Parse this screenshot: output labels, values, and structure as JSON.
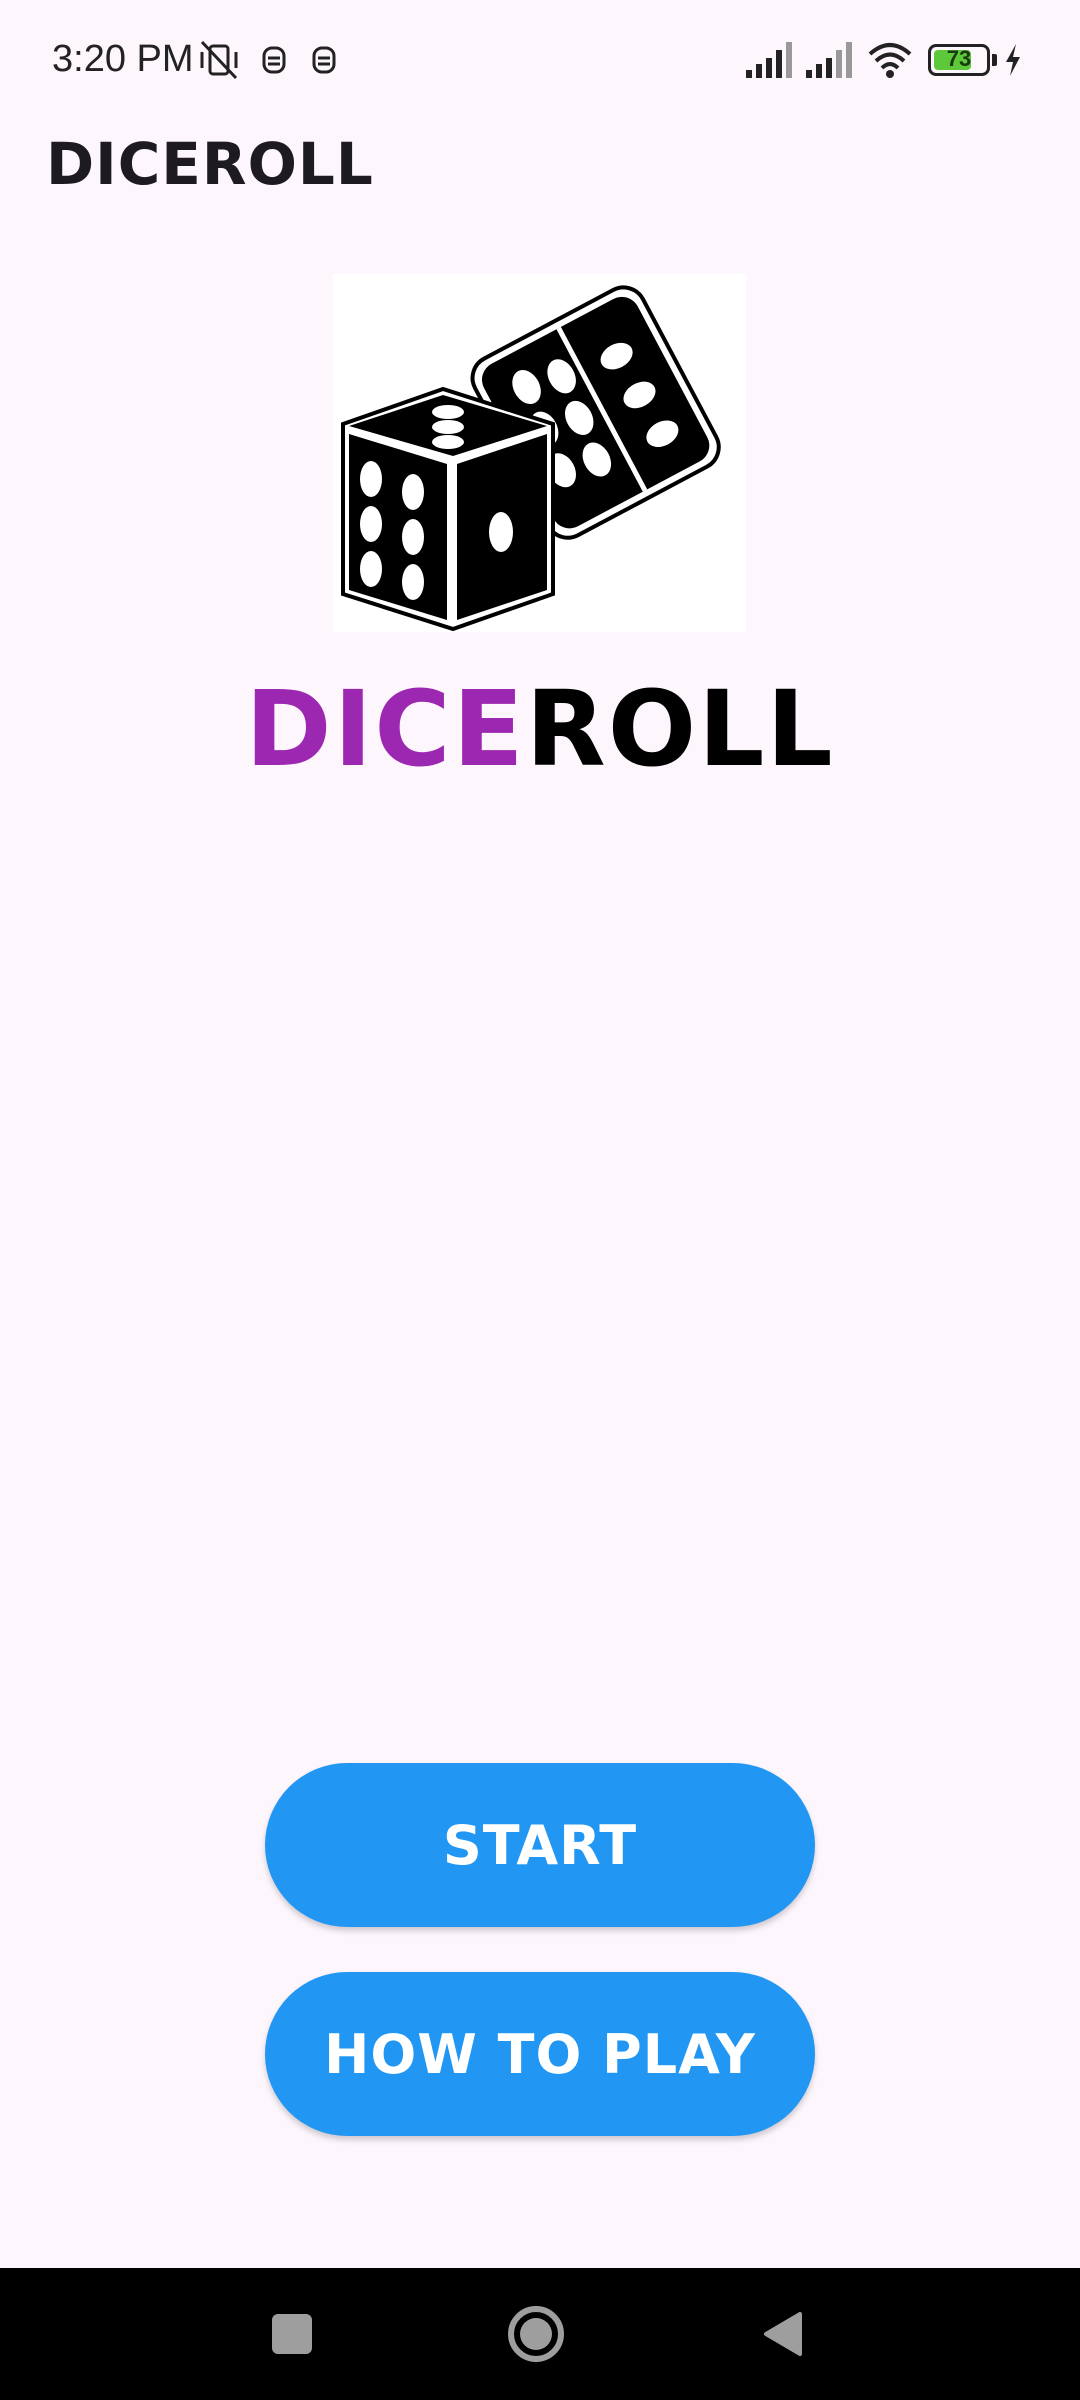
{
  "status_bar": {
    "time": "3:20 PM",
    "battery_level": "73",
    "battery_fraction": 0.73,
    "icons": [
      "muted-vibrate-icon",
      "notification-icon",
      "notification-icon",
      "signal-icon",
      "signal-icon",
      "wifi-icon",
      "battery-icon",
      "charging-icon"
    ]
  },
  "app_bar": {
    "title": "DICEROLL"
  },
  "logo": {
    "icon": "dice-icon"
  },
  "brand": {
    "part1": "DICE",
    "part2": "ROLL",
    "part1_color": "#9c27b0",
    "part2_color": "#000000"
  },
  "buttons": {
    "start_label": "START",
    "how_to_play_label": "HOW TO PLAY",
    "color": "#2196f3"
  },
  "nav_bar": {
    "icons": [
      "recents-icon",
      "home-icon",
      "back-icon"
    ]
  }
}
